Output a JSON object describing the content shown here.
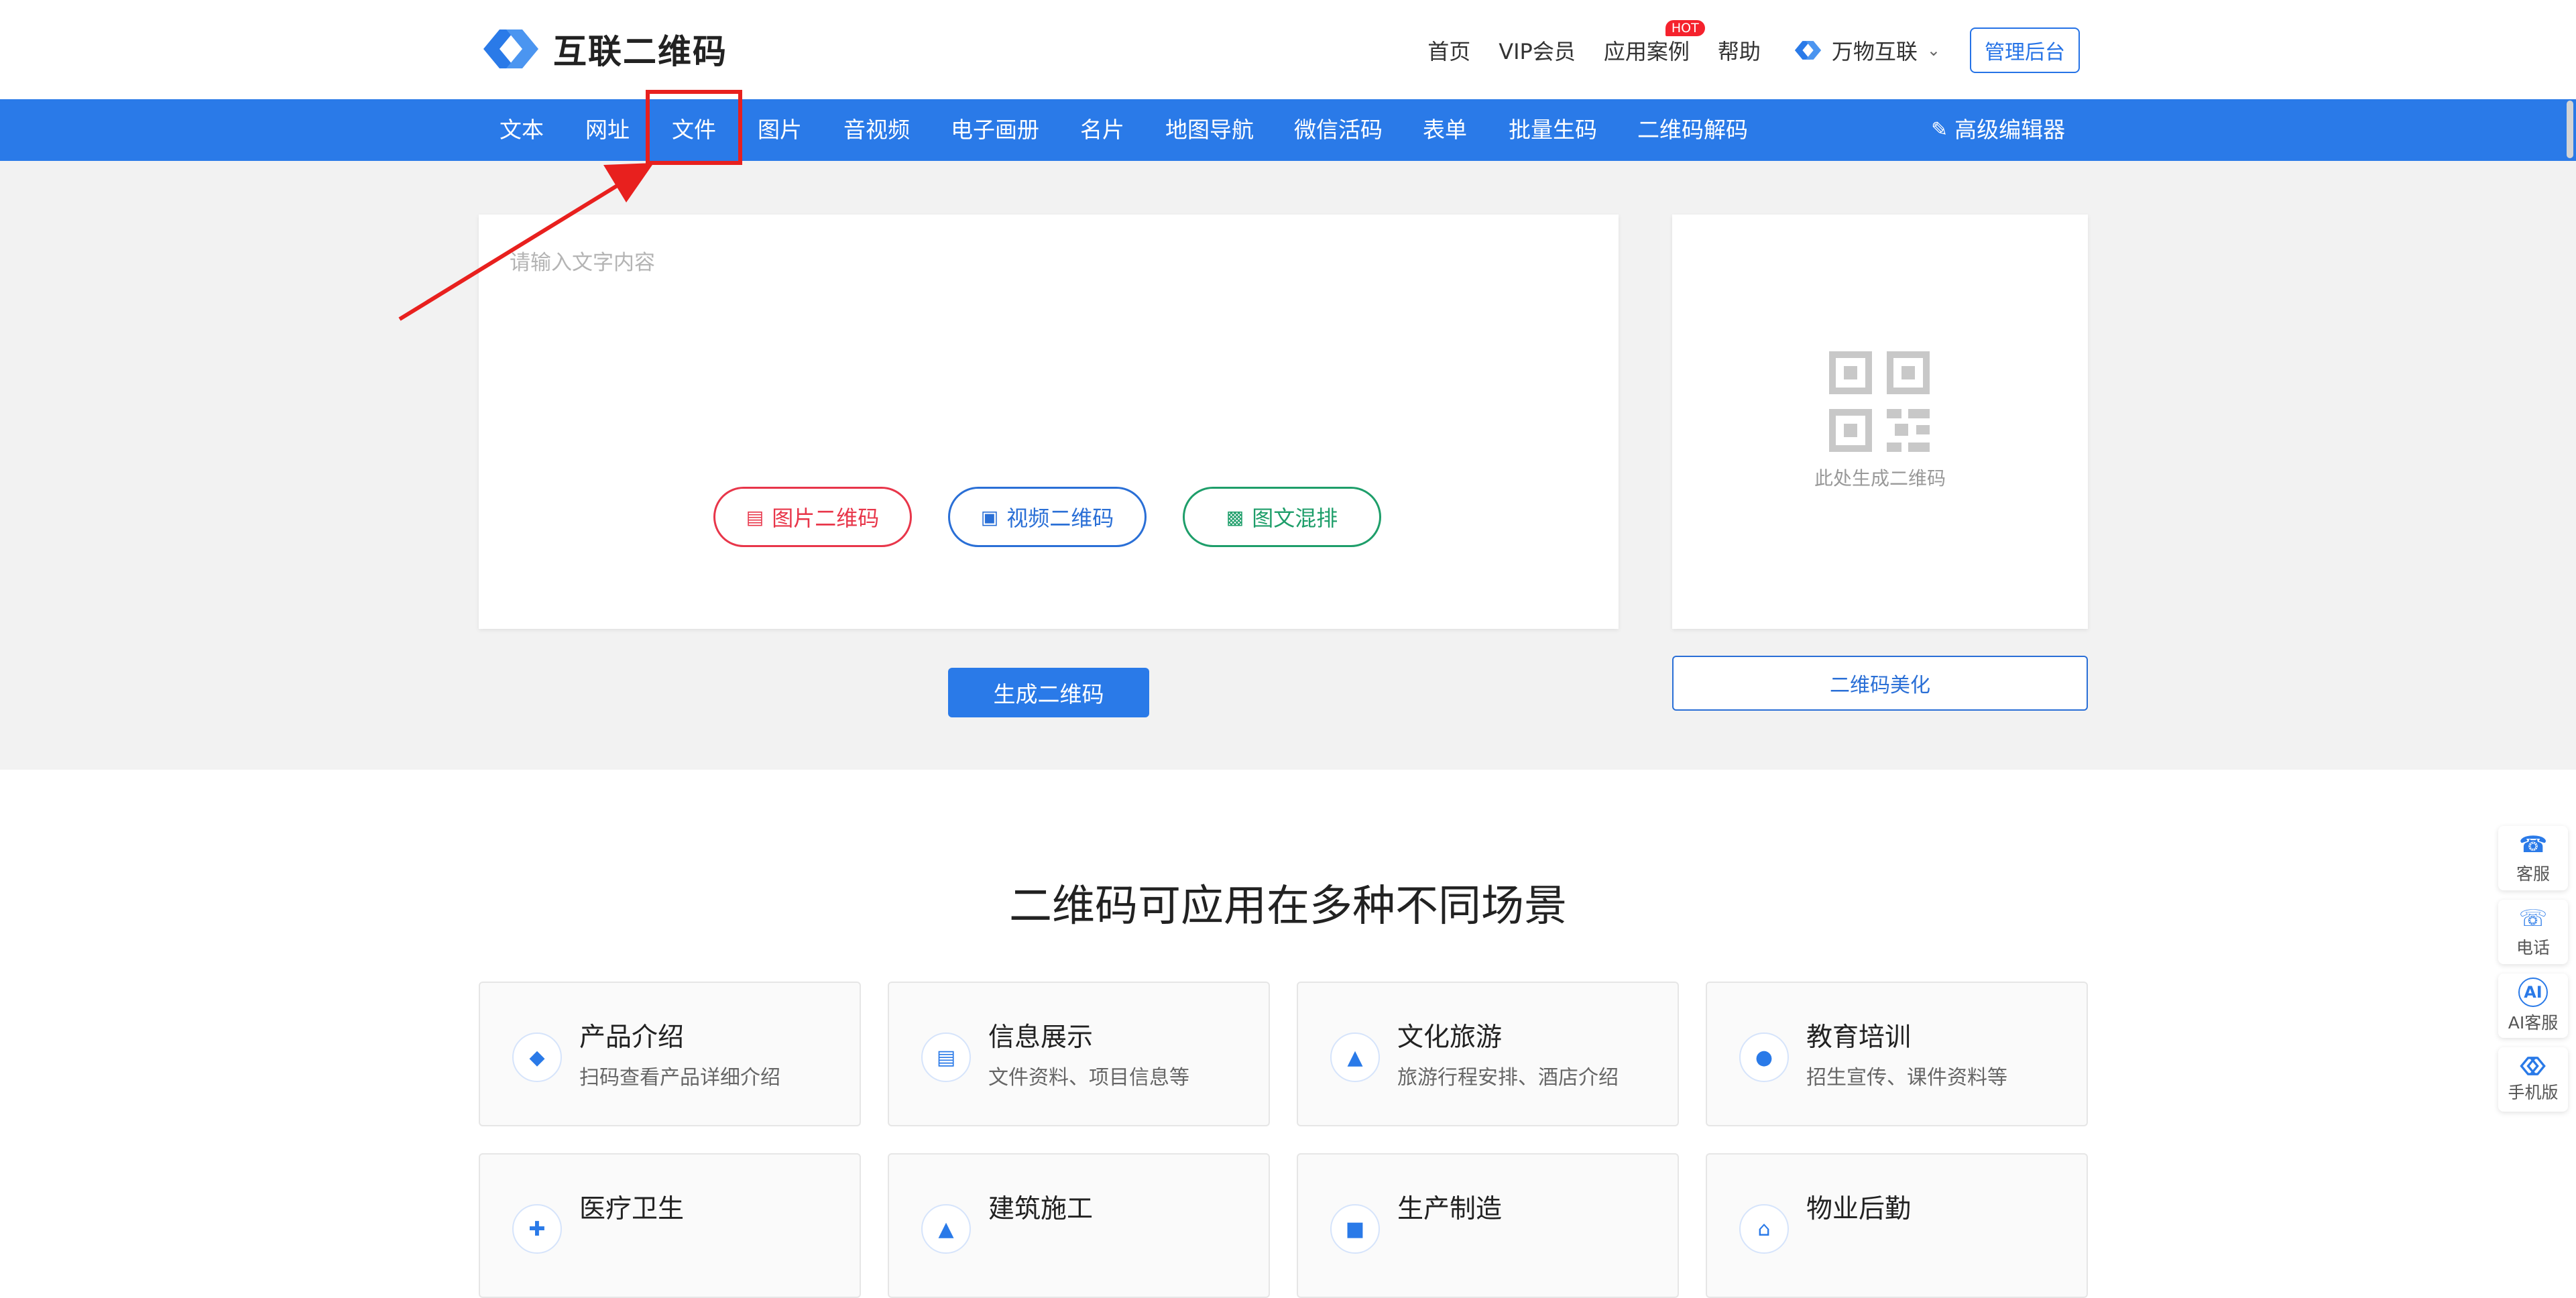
{
  "header": {
    "logo_text": "互联二维码",
    "nav": [
      "首页",
      "VIP会员",
      "应用案例",
      "帮助"
    ],
    "hot_badge": "HOT",
    "brand_link": "万物互联",
    "admin_button": "管理后台"
  },
  "tabs": [
    "文本",
    "网址",
    "文件",
    "图片",
    "音视频",
    "电子画册",
    "名片",
    "地图导航",
    "微信活码",
    "表单",
    "批量生码",
    "二维码解码"
  ],
  "advanced_editor": "高级编辑器",
  "editor": {
    "placeholder": "请输入文字内容",
    "pills": {
      "image": "图片二维码",
      "video": "视频二维码",
      "mixed": "图文混排"
    },
    "generate_button": "生成二维码"
  },
  "qr_preview": {
    "placeholder": "此处生成二维码",
    "beautify_button": "二维码美化"
  },
  "scenarios": {
    "title": "二维码可应用在多种不同场景",
    "items": [
      {
        "title": "产品介绍",
        "desc": "扫码查看产品详细介绍",
        "icon": "cube-icon"
      },
      {
        "title": "信息展示",
        "desc": "文件资料、项目信息等",
        "icon": "document-icon"
      },
      {
        "title": "文化旅游",
        "desc": "旅游行程安排、酒店介绍",
        "icon": "travel-icon"
      },
      {
        "title": "教育培训",
        "desc": "招生宣传、课件资料等",
        "icon": "graduation-cap-icon"
      },
      {
        "title": "医疗卫生",
        "desc": "",
        "icon": "medical-icon"
      },
      {
        "title": "建筑施工",
        "desc": "",
        "icon": "construction-icon"
      },
      {
        "title": "生产制造",
        "desc": "",
        "icon": "factory-icon"
      },
      {
        "title": "物业后勤",
        "desc": "",
        "icon": "property-icon"
      }
    ]
  },
  "sidebar": [
    {
      "label": "客服",
      "icon": "headset-icon"
    },
    {
      "label": "电话",
      "icon": "phone-icon"
    },
    {
      "label": "AI客服",
      "icon": "ai-chat-icon"
    },
    {
      "label": "手机版",
      "icon": "mobile-logo-icon"
    }
  ],
  "colors": {
    "primary": "#2a7ae8",
    "annotation": "#e8201e",
    "pill_red": "#e8364a",
    "pill_green": "#1e9e6a"
  }
}
